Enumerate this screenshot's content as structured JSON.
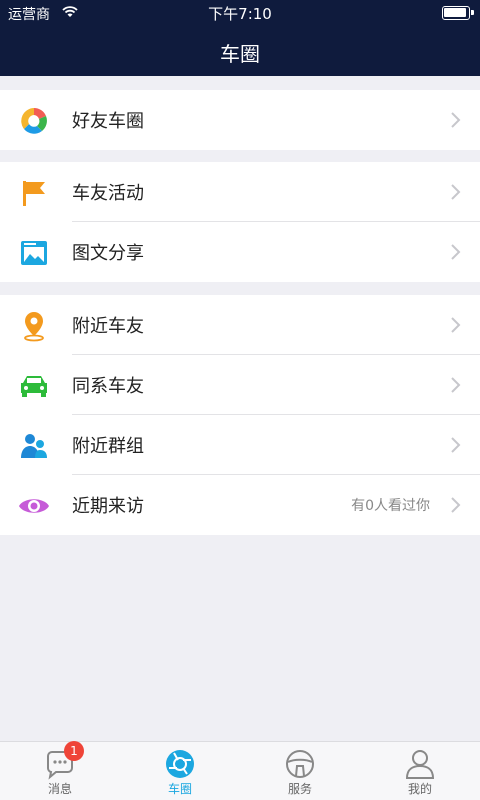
{
  "status": {
    "carrier": "运营商",
    "time": "下午7:10"
  },
  "nav": {
    "title": "车圈"
  },
  "sections": [
    {
      "items": [
        {
          "label": "好友车圈",
          "icon": "friends-circle-icon"
        }
      ]
    },
    {
      "items": [
        {
          "label": "车友活动",
          "icon": "flag-icon"
        },
        {
          "label": "图文分享",
          "icon": "image-icon"
        }
      ]
    },
    {
      "items": [
        {
          "label": "附近车友",
          "icon": "location-pin-icon"
        },
        {
          "label": "同系车友",
          "icon": "car-icon"
        },
        {
          "label": "附近群组",
          "icon": "group-icon"
        },
        {
          "label": "近期来访",
          "icon": "eye-icon",
          "hint": "有0人看过你"
        }
      ]
    }
  ],
  "tabs": [
    {
      "label": "消息",
      "icon": "chat-icon",
      "badge": "1"
    },
    {
      "label": "车圈",
      "icon": "car-circle-icon",
      "active": true
    },
    {
      "label": "服务",
      "icon": "steering-wheel-icon"
    },
    {
      "label": "我的",
      "icon": "profile-icon"
    }
  ],
  "colors": {
    "header": "#0f1b3d",
    "accent": "#1ca7e0",
    "badge": "#ef4438"
  }
}
